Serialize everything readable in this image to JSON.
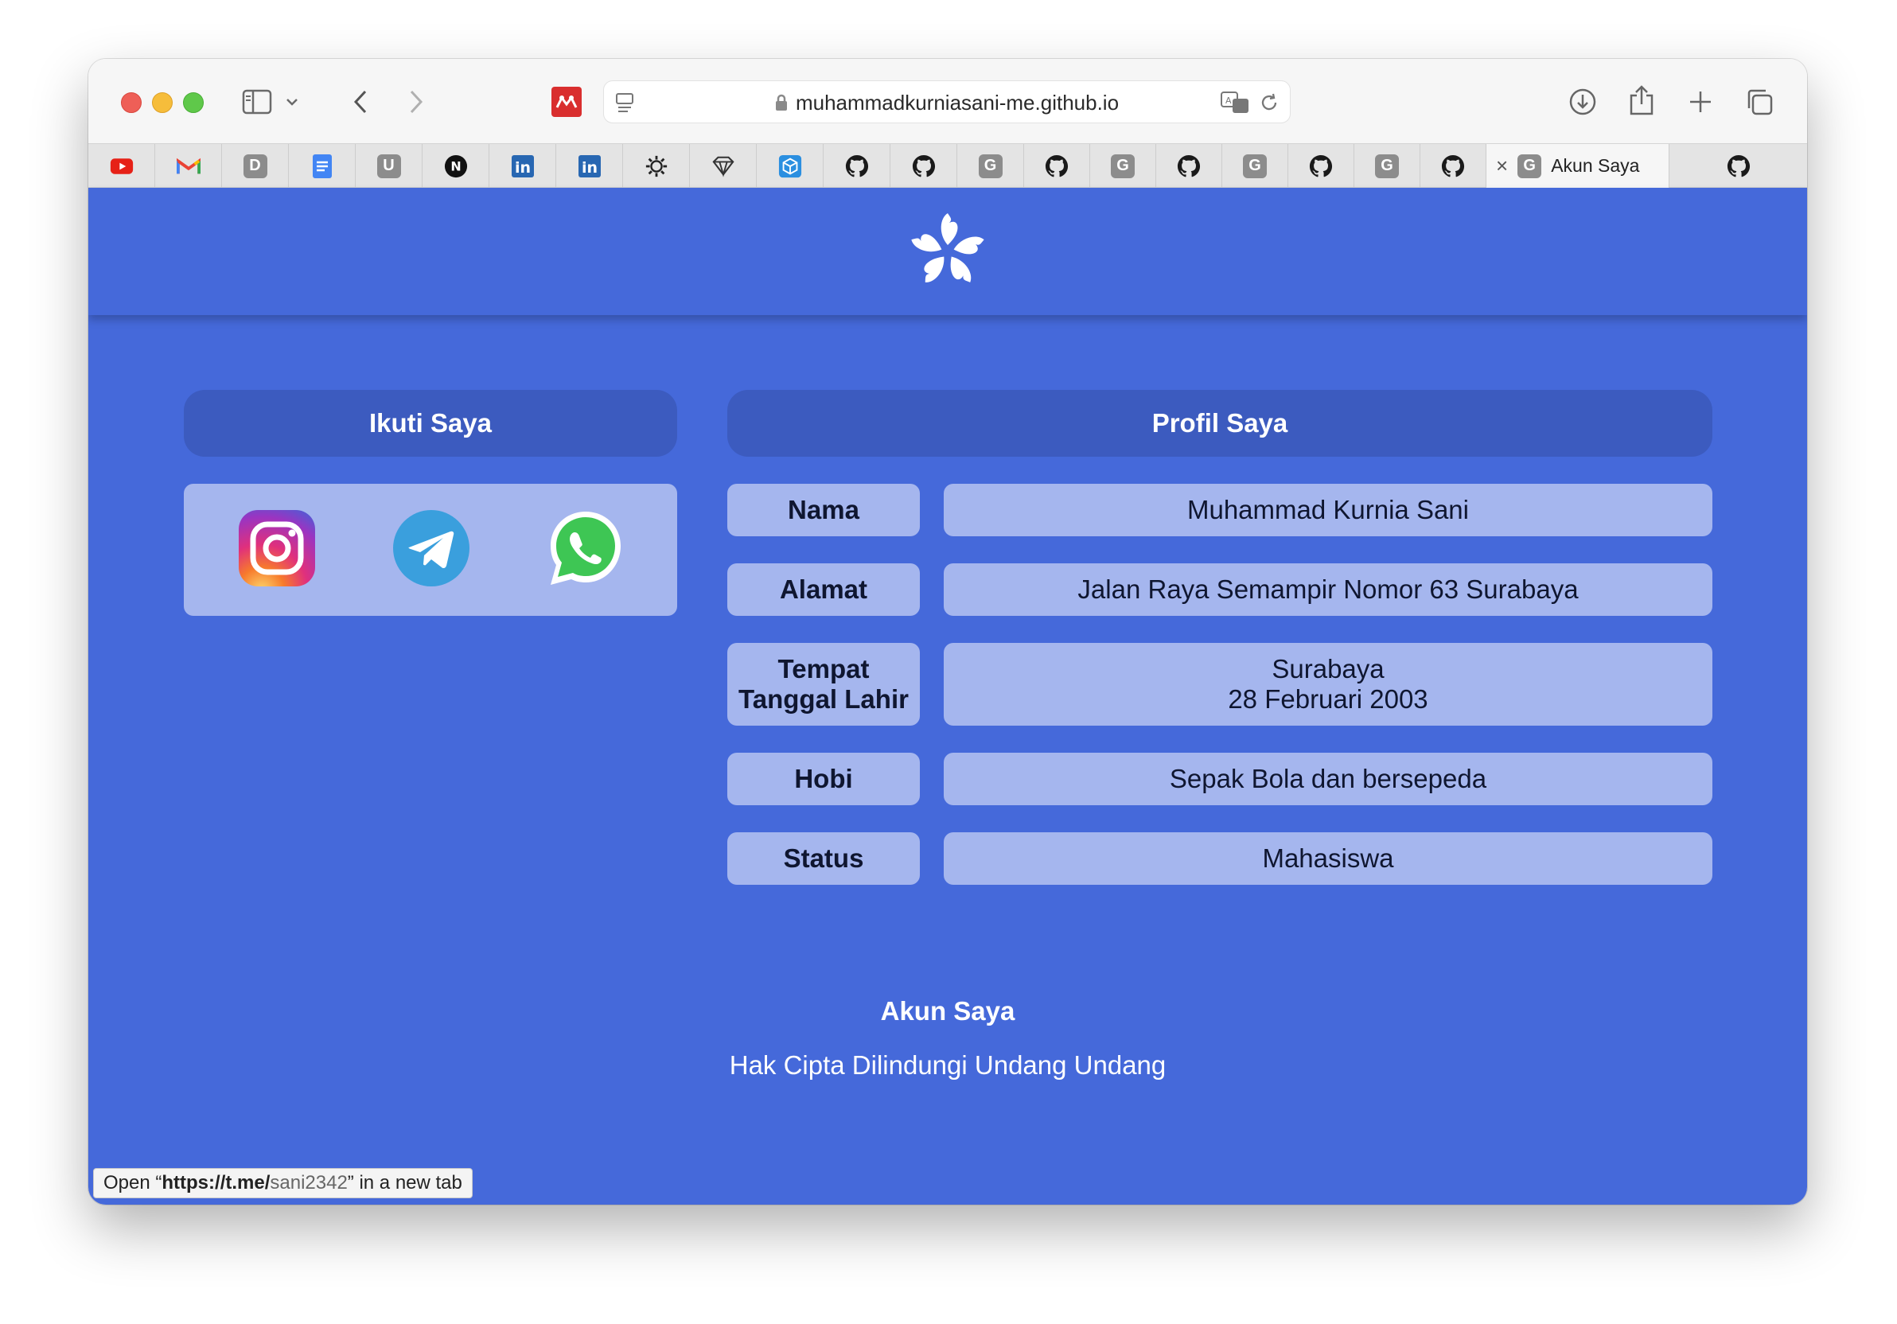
{
  "browser": {
    "url": "muhammadkurniasani-me.github.io",
    "status_link_prefix": "Open “",
    "status_link_host": "https://t.me/",
    "status_link_path": "sani2342",
    "status_link_suffix": "” in a new tab"
  },
  "tabs": [
    {
      "icon": "youtube-icon"
    },
    {
      "icon": "gmail-icon"
    },
    {
      "icon": "letter-d-icon",
      "letter": "D"
    },
    {
      "icon": "google-docs-icon"
    },
    {
      "icon": "letter-u-icon",
      "letter": "U"
    },
    {
      "icon": "notion-icon",
      "letter": "N"
    },
    {
      "icon": "linkedin-icon",
      "letter": "in"
    },
    {
      "icon": "linkedin-icon",
      "letter": "in"
    },
    {
      "icon": "gear-icon"
    },
    {
      "icon": "diamond-icon"
    },
    {
      "icon": "cube-icon"
    },
    {
      "icon": "github-icon"
    },
    {
      "icon": "github-icon"
    },
    {
      "icon": "letter-g-icon",
      "letter": "G"
    },
    {
      "icon": "github-icon"
    },
    {
      "icon": "letter-g-icon",
      "letter": "G"
    },
    {
      "icon": "github-icon"
    },
    {
      "icon": "letter-g-icon",
      "letter": "G"
    },
    {
      "icon": "github-icon"
    },
    {
      "icon": "letter-g-icon",
      "letter": "G"
    },
    {
      "icon": "github-icon"
    }
  ],
  "active_tab": {
    "letter": "G",
    "title": "Akun Saya",
    "close": "×"
  },
  "last_tab": {
    "icon": "github-icon"
  },
  "follow": {
    "title": "Ikuti Saya",
    "links": [
      {
        "name": "instagram",
        "icon": "instagram-icon"
      },
      {
        "name": "telegram",
        "icon": "telegram-icon"
      },
      {
        "name": "whatsapp",
        "icon": "whatsapp-icon"
      }
    ]
  },
  "profile": {
    "title": "Profil Saya",
    "rows": [
      {
        "label": "Nama",
        "value": "Muhammad Kurnia Sani"
      },
      {
        "label": "Alamat",
        "value": "Jalan Raya Semampir Nomor 63 Surabaya"
      },
      {
        "label_line1": "Tempat",
        "label_line2": "Tanggal Lahir",
        "value_line1": "Surabaya",
        "value_line2": "28 Februari 2003"
      },
      {
        "label": "Hobi",
        "value": "Sepak Bola dan bersepeda"
      },
      {
        "label": "Status",
        "value": "Mahasiswa"
      }
    ]
  },
  "footer": {
    "title": "Akun Saya",
    "copyright": "Hak Cipta Dilindungi Undang Undang"
  },
  "colors": {
    "page_bg": "#4569da",
    "panel_title_bg": "#3c5bbf",
    "cell_bg": "#a5b6ee"
  }
}
